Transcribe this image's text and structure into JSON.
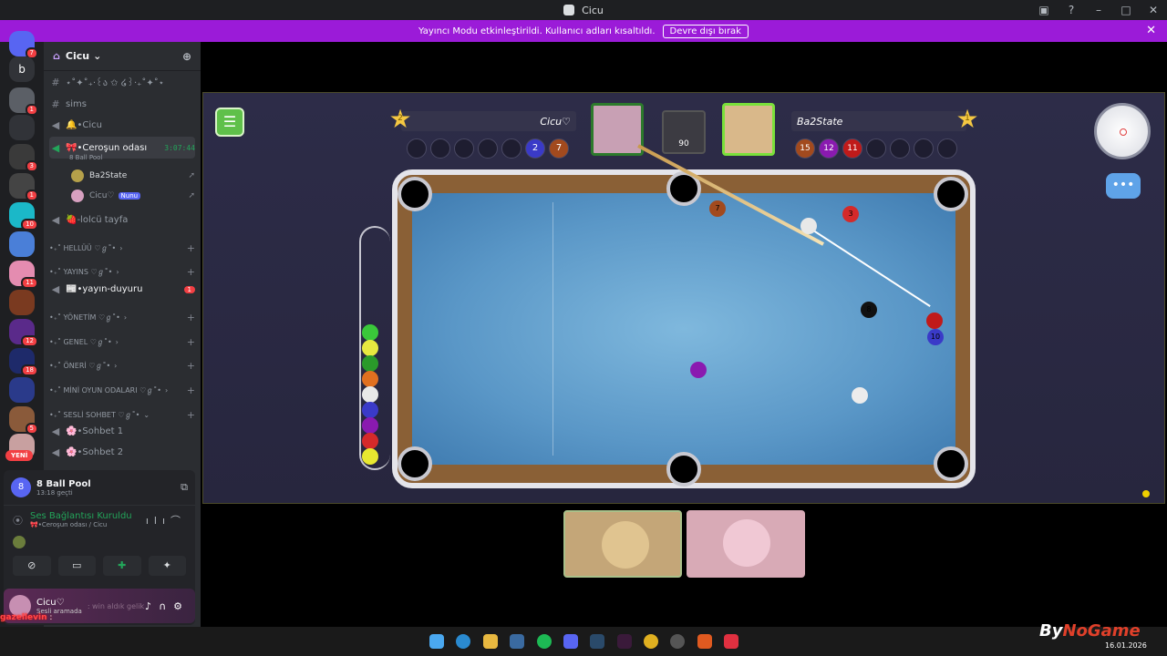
{
  "window": {
    "title": "Cicu"
  },
  "banner": {
    "text": "Yayıncı Modu etkinleştirildi. Kullanıcı adları kısaltıldı.",
    "button": "Devre dışı bırak"
  },
  "rail": {
    "top_letter": "b",
    "badges": [
      "7",
      "1",
      "3",
      "1",
      "10",
      "11",
      "12",
      "18",
      "5"
    ],
    "new_label": "YENİ"
  },
  "server": {
    "name": "Cicu"
  },
  "channels": {
    "c1": "⋆˚✦˚₊‧꒰ა ✩ ໒꒱‧₊˚✦˚⋆",
    "c2": "sims",
    "c3": "🔔•Cicu",
    "active_name": "🎀•Ceroşun odası",
    "active_timer": "3:07:44",
    "active_activity": "8 Ball Pool",
    "members": [
      {
        "name": "Ba2State",
        "tag": ""
      },
      {
        "name": "Cicu♡",
        "tag": "Nunu"
      }
    ],
    "c4": "🍓-lolcü tayfa",
    "cat1": "•₊˚ HELLÜÜ ♡ℊ˚•",
    "cat2": "•₊˚ YAYINS ♡ℊ˚•",
    "c5": "📰•yayın-duyuru",
    "c5_unread": "1",
    "cat3": "•₊˚ YÖNETİM ♡ℊ˚•",
    "cat4": "•₊˚ GENEL ♡ℊ˚•",
    "cat5": "•₊˚ ÖNERİ ♡ℊ˚•",
    "cat6": "•₊˚ MİNİ OYUN ODALARI ♡ℊ˚•",
    "cat7": "•₊˚ SESLİ SOHBET ♡ℊ˚•",
    "c6": "🌸•Sohbet 1",
    "c7": "🌸•Sohbet 2"
  },
  "activity": {
    "title": "8 Ball Pool",
    "subtitle": "13:18 geçti"
  },
  "voice": {
    "status": "Ses Bağlantısı Kuruldu",
    "location": "🎀•Ceroşun odası / Cicu"
  },
  "user": {
    "name": "Cicu♡",
    "status": "Sesli aramada",
    "ghost": ": win aldık gelik"
  },
  "chat_snip": {
    "name": "gazellevin",
    "text": " :"
  },
  "game": {
    "player1": {
      "name": "Cicu♡",
      "level": "2",
      "balls": [
        "2",
        "7"
      ]
    },
    "player2": {
      "name": "Ba2State",
      "level": "1",
      "balls": [
        "15",
        "12",
        "11"
      ]
    },
    "pot": "90",
    "rack_balls": 9,
    "table_balls": [
      {
        "num": "7",
        "color": "#a24a1e"
      },
      {
        "num": "",
        "color": "#e8e8e8"
      },
      {
        "num": "3",
        "color": "#d42a2a"
      },
      {
        "num": "8",
        "color": "#111111"
      },
      {
        "num": "",
        "color": "#c01a1a"
      },
      {
        "num": "10",
        "color": "#3a3ac8"
      },
      {
        "num": "",
        "color": "#8a1ab0"
      },
      {
        "num": "",
        "color": "#ececec"
      }
    ]
  },
  "watermark": {
    "text_a": "By",
    "text_b": "NoGame",
    "date": "16.01.2026"
  },
  "colors": {
    "banner": "#9b1bd8",
    "accent": "#5865f2",
    "online": "#23a55a"
  }
}
